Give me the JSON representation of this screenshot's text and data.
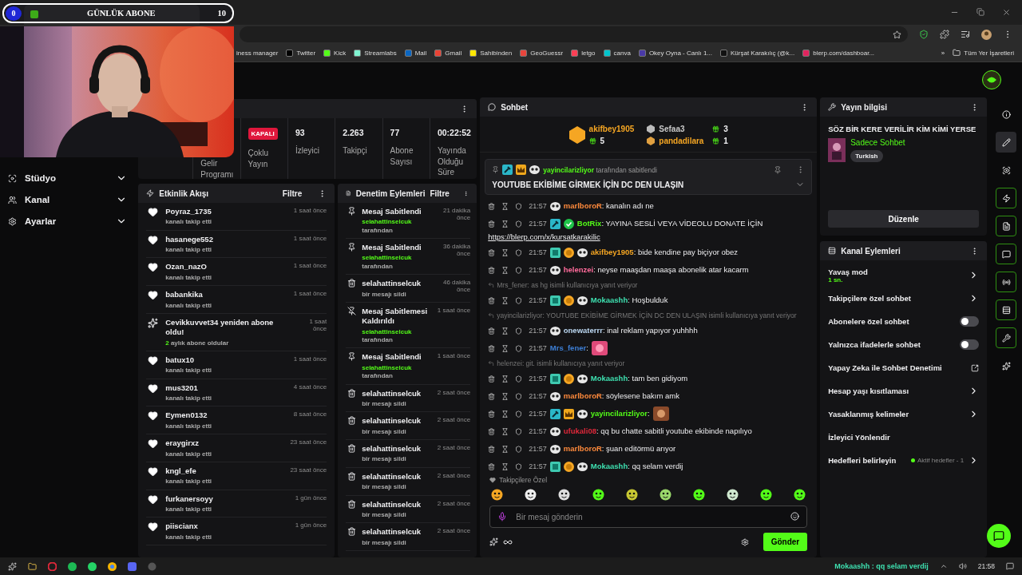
{
  "stream_overlay": {
    "current": "0",
    "title": "GÜNLÜK ABONE",
    "goal": "10"
  },
  "browser": {
    "bookmarks": [
      {
        "label": "iness manager"
      },
      {
        "label": "Twitter",
        "kind": "x"
      },
      {
        "label": "Kick",
        "kind": "kick"
      },
      {
        "label": "Streamlabs",
        "kind": "streamlabs"
      },
      {
        "label": "Mail",
        "kind": "mail"
      },
      {
        "label": "Gmail",
        "kind": "gmail"
      },
      {
        "label": "Sahibinden",
        "kind": "sahibinden"
      },
      {
        "label": "GeoGuessr",
        "kind": "pin"
      },
      {
        "label": "letgo",
        "kind": "letgo"
      },
      {
        "label": "canva",
        "kind": "canva"
      },
      {
        "label": "Okey Oyna - Canlı 1...",
        "kind": "okey"
      },
      {
        "label": "Kürşat Karakılıç (@k...",
        "kind": "note"
      },
      {
        "label": "blerp.com/dashboar...",
        "kind": "blerp"
      }
    ],
    "more": "»",
    "other_bookmarks": "Tüm Yer İşaretleri"
  },
  "sidebar": {
    "items": [
      {
        "label": "Stüdyo",
        "kind": "studio",
        "expanded": false
      },
      {
        "label": "Kanal",
        "kind": "channel",
        "expanded": false
      },
      {
        "label": "Ayarlar",
        "kind": "settings",
        "expanded": false
      }
    ]
  },
  "stats": [
    {
      "label": "Gelir Programı"
    },
    {
      "badge": "KAPALI",
      "label": "Çoklu Yayın"
    },
    {
      "value": "93",
      "label": "İzleyici"
    },
    {
      "value": "2.263",
      "label": "Takipçi"
    },
    {
      "value": "77",
      "label": "Abone Sayısı"
    },
    {
      "value": "00:22:52",
      "label": "Yayında Olduğu Süre"
    }
  ],
  "activity_feed": {
    "title": "Etkinlik Akışı",
    "filter": "Filtre",
    "events": [
      {
        "kind": "follow",
        "user": "Poyraz_1735",
        "detail": "kanalı takip etti",
        "time": "1 saat önce"
      },
      {
        "kind": "follow",
        "user": "hasanege552",
        "detail": "kanalı takip etti",
        "time": "1 saat önce"
      },
      {
        "kind": "follow",
        "user": "Ozan_nazO",
        "detail": "kanalı takip etti",
        "time": "1 saat önce"
      },
      {
        "kind": "follow",
        "user": "babankika",
        "detail": "kanalı takip etti",
        "time": "1 saat önce"
      },
      {
        "kind": "resub",
        "user": "Cevikkuvvet34 yeniden abone oldu!",
        "count": "2",
        "detail": "aylık abone oldular",
        "time": "1 saat önce"
      },
      {
        "kind": "follow",
        "user": "batux10",
        "detail": "kanalı takip etti",
        "time": "1 saat önce"
      },
      {
        "kind": "follow",
        "user": "mus3201",
        "detail": "kanalı takip etti",
        "time": "4 saat önce"
      },
      {
        "kind": "follow",
        "user": "Eymen0132",
        "detail": "kanalı takip etti",
        "time": "8 saat önce"
      },
      {
        "kind": "follow",
        "user": "eraygirxz",
        "detail": "kanalı takip etti",
        "time": "23 saat önce"
      },
      {
        "kind": "follow",
        "user": "kngl_efe",
        "detail": "kanalı takip etti",
        "time": "23 saat önce"
      },
      {
        "kind": "follow",
        "user": "furkanersoyy",
        "detail": "kanalı takip etti",
        "time": "1 gün önce"
      },
      {
        "kind": "follow",
        "user": "piiscianx",
        "detail": "kanalı takip etti",
        "time": "1 gün önce"
      }
    ]
  },
  "moderation": {
    "title": "Denetim Eylemleri",
    "filter": "Filtre",
    "actions": [
      {
        "kind": "pin",
        "title": "Mesaj Sabitlendi",
        "user": "selahattinselcuk",
        "suffix": "tarafından",
        "time": "21 dakika önce"
      },
      {
        "kind": "pin",
        "title": "Mesaj Sabitlendi",
        "user": "selahattinselcuk",
        "suffix": "tarafından",
        "time": "36 dakika önce"
      },
      {
        "kind": "delete",
        "title": "selahattinselcuk",
        "detail": "bir mesajı sildi",
        "time": "46 dakika önce"
      },
      {
        "kind": "unpin",
        "title": "Mesaj Sabitlemesi Kaldırıldı",
        "user": "selahattinselcuk",
        "suffix": "tarafından",
        "time": "1 saat önce"
      },
      {
        "kind": "pin",
        "title": "Mesaj Sabitlendi",
        "user": "selahattinselcuk",
        "suffix": "tarafından",
        "time": "1 saat önce"
      },
      {
        "kind": "delete",
        "title": "selahattinselcuk",
        "detail": "bir mesajı sildi",
        "time": "2 saat önce"
      },
      {
        "kind": "delete",
        "title": "selahattinselcuk",
        "detail": "bir mesajı sildi",
        "time": "2 saat önce"
      },
      {
        "kind": "delete",
        "title": "selahattinselcuk",
        "detail": "bir mesajı sildi",
        "time": "2 saat önce"
      },
      {
        "kind": "delete",
        "title": "selahattinselcuk",
        "detail": "bir mesajı sildi",
        "time": "2 saat önce"
      },
      {
        "kind": "delete",
        "title": "selahattinselcuk",
        "detail": "bir mesajı sildi",
        "time": "2 saat önce"
      },
      {
        "kind": "delete",
        "title": "selahattinselcuk",
        "detail": "bir mesajı sildi",
        "time": "2 saat önce"
      }
    ]
  },
  "chat": {
    "title": "Sohbet",
    "leaderboard": [
      {
        "user": "akifbey1905",
        "gifts": "5",
        "color": "#f5a623"
      },
      {
        "user": "Sefaa3",
        "gifts": "3",
        "color": "#c8c8c8"
      },
      {
        "user": "pandadilara",
        "gifts": "1",
        "color": "#f5a623"
      }
    ],
    "pinned": {
      "user": "yayincilarizliyor",
      "by": "tarafından sabitlendi",
      "text": "YOUTUBE EKİBİME GİRMEK İÇİN DC DEN ULAŞIN"
    },
    "messages": [
      {
        "kind": "message",
        "time": "21:57",
        "badges": [
          {
            "kind": "panda"
          }
        ],
        "user": "marlboroR",
        "color": "#ff8a3c",
        "text": ": kanalın adı ne"
      },
      {
        "kind": "message",
        "time": "21:57",
        "badges": [
          {
            "kind": "mod"
          },
          {
            "kind": "verified"
          }
        ],
        "user": "BotRix",
        "color": "#53fc18",
        "text": ": YAYINA SESLİ VEYA VİDEOLU DONATE İÇİN",
        "link": "https://blerp.com/x/kursatkarakilic"
      },
      {
        "kind": "message",
        "time": "21:57",
        "badges": [
          {
            "kind": "sub"
          },
          {
            "kind": "rank"
          },
          {
            "kind": "panda"
          }
        ],
        "user": "akifbey1905",
        "color": "#f5a623",
        "text": ": bide kendine pay biçiyor obez"
      },
      {
        "kind": "message",
        "time": "21:57",
        "badges": [
          {
            "kind": "panda"
          }
        ],
        "user": "helenzei",
        "color": "#ff6b9b",
        "text": ": neyse maaşdan maaşa abonelik atar kacarm"
      },
      {
        "kind": "reply",
        "text": "Mrs_fener: as hg isimli kullanıcıya yanıt veriyor"
      },
      {
        "kind": "message",
        "time": "21:57",
        "badges": [
          {
            "kind": "sub"
          },
          {
            "kind": "rank"
          },
          {
            "kind": "panda"
          }
        ],
        "user": "Mokaashh",
        "color": "#3ee0b0",
        "text": ": Hoşbulduk"
      },
      {
        "kind": "reply",
        "text": "yayincilarizliyor: YOUTUBE EKİBİME GİRMEK İÇİN DC DEN ULAŞIN isimli kullanıcıya yanıt veriyor"
      },
      {
        "kind": "message",
        "time": "21:57",
        "badges": [
          {
            "kind": "panda"
          }
        ],
        "user": "onewaterrr",
        "color": "#bcd8f2",
        "text": ": inal reklam yapıyor yuhhhh"
      },
      {
        "kind": "message",
        "time": "21:57",
        "user": "Mrs_fener",
        "color": "#3d7fd6",
        "text": ":",
        "emote": true
      },
      {
        "kind": "reply",
        "text": "helenzei: git. isimli kullanıcıya yanıt veriyor"
      },
      {
        "kind": "message",
        "time": "21:57",
        "badges": [
          {
            "kind": "sub"
          },
          {
            "kind": "rank"
          },
          {
            "kind": "panda"
          }
        ],
        "user": "Mokaashh",
        "color": "#3ee0b0",
        "text": ": tam ben gidiyom"
      },
      {
        "kind": "message",
        "time": "21:57",
        "badges": [
          {
            "kind": "panda"
          }
        ],
        "user": "marlboroR",
        "color": "#ff8a3c",
        "text": ": söylesene bakım amk"
      },
      {
        "kind": "message",
        "time": "21:57",
        "badges": [
          {
            "kind": "mod"
          },
          {
            "kind": "crown"
          },
          {
            "kind": "panda"
          }
        ],
        "user": "yayincilarizliyor",
        "color": "#53fc18",
        "text": ":",
        "emote": true
      },
      {
        "kind": "message",
        "time": "21:57",
        "badges": [
          {
            "kind": "panda"
          }
        ],
        "user": "ufukali08",
        "color": "#e0283a",
        "text": ": qq bu chatte sabitli youtube ekibinde napılıyo"
      },
      {
        "kind": "message",
        "time": "21:57",
        "badges": [
          {
            "kind": "panda"
          }
        ],
        "user": "marlboroR",
        "color": "#ff8a3c",
        "text": ": şuan editörmü arıyor"
      },
      {
        "kind": "message",
        "time": "21:57",
        "badges": [
          {
            "kind": "sub"
          },
          {
            "kind": "rank"
          },
          {
            "kind": "panda"
          }
        ],
        "user": "Mokaashh",
        "color": "#3ee0b0",
        "text": ": qq selam verdij"
      }
    ],
    "emote_section": "Takipçilere Özel",
    "input": {
      "placeholder": "Bir mesaj gönderin"
    },
    "send": "Gönder"
  },
  "stream_info": {
    "title": "Yayın bilgisi",
    "stream_title": "SÖZ BİR KERE VERİLİR KİM KİMİ YERSE",
    "category": "Sadece Sohbet",
    "tag": "Turkish",
    "edit": "Düzenle"
  },
  "channel_actions": {
    "title": "Kanal Eylemleri",
    "items": [
      {
        "kind": "link",
        "label": "Yavaş mod",
        "value": "1 sn."
      },
      {
        "kind": "link",
        "label": "Takipçilere özel sohbet"
      },
      {
        "kind": "toggle",
        "label": "Abonelere özel sohbet",
        "on": false
      },
      {
        "kind": "toggle",
        "label": "Yalnızca ifadelerle sohbet",
        "on": false
      },
      {
        "kind": "external",
        "label": "Yapay Zeka ile Sohbet Denetimi"
      },
      {
        "kind": "link",
        "label": "Hesap yaşı kısıtlaması"
      },
      {
        "kind": "link",
        "label": "Yasaklanmış kelimeler"
      },
      {
        "kind": "plain",
        "label": "İzleyici Yönlendir"
      },
      {
        "kind": "link",
        "label": "Hedefleri belirleyin",
        "status": "Aktif hedefler - 1"
      }
    ]
  },
  "rail": [
    {
      "kind": "info",
      "selected": false,
      "active": false
    },
    {
      "kind": "edit",
      "selected": true,
      "active": false
    },
    {
      "kind": "studio",
      "selected": false,
      "active": false
    },
    {
      "kind": "activity",
      "selected": false,
      "active": true
    },
    {
      "kind": "log",
      "selected": false,
      "active": true
    },
    {
      "kind": "chat",
      "selected": false,
      "active": true
    },
    {
      "kind": "broadcast",
      "selected": false,
      "active": true
    },
    {
      "kind": "actions",
      "selected": false,
      "active": true
    },
    {
      "kind": "tools",
      "selected": false,
      "active": true
    },
    {
      "kind": "more",
      "selected": false,
      "active": false
    }
  ],
  "taskbar": {
    "notification": "Mokaashh : qq selam verdij",
    "clock": "21:58"
  }
}
